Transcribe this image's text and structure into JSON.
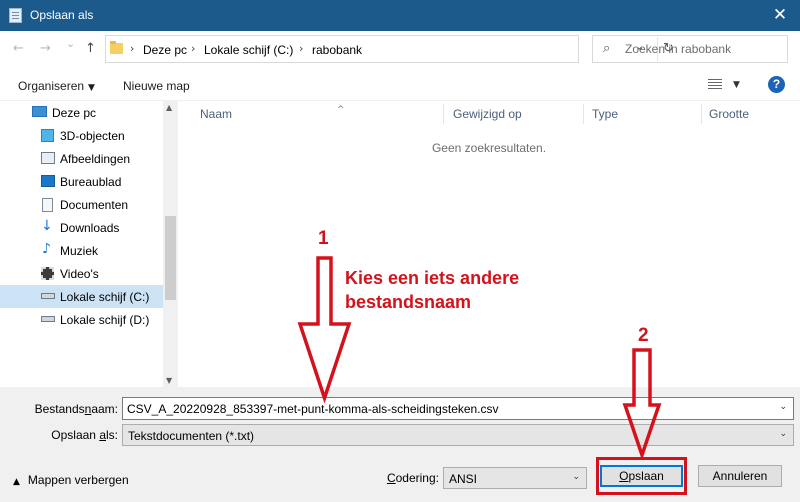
{
  "window": {
    "title": "Opslaan als",
    "close_glyph": "✕"
  },
  "nav_buttons": {
    "back": "←",
    "forward": "→",
    "recent": "⌄",
    "up": "↑"
  },
  "address": {
    "crumbs": [
      "Deze pc",
      "Lokale schijf (C:)",
      "rabobank"
    ],
    "separator": "›",
    "dropdown": "⌄",
    "refresh": "↻"
  },
  "search": {
    "placeholder": "Zoeken in rabobank",
    "icon": "⌕"
  },
  "toolbar": {
    "organize": "Organiseren",
    "organize_caret": "▼",
    "new_folder": "Nieuwe map",
    "view_caret": "▼",
    "help": "?"
  },
  "sidebar": {
    "items": [
      {
        "label": "Deze pc",
        "icon": "computer-icon"
      },
      {
        "label": "3D-objecten",
        "icon": "cube-icon"
      },
      {
        "label": "Afbeeldingen",
        "icon": "pictures-icon"
      },
      {
        "label": "Bureaublad",
        "icon": "desktop-icon"
      },
      {
        "label": "Documenten",
        "icon": "documents-icon"
      },
      {
        "label": "Downloads",
        "icon": "download-icon"
      },
      {
        "label": "Muziek",
        "icon": "music-icon"
      },
      {
        "label": "Video's",
        "icon": "video-icon"
      },
      {
        "label": "Lokale schijf (C:)",
        "icon": "drive-icon",
        "selected": true
      },
      {
        "label": "Lokale schijf (D:)",
        "icon": "drive-icon"
      }
    ],
    "scroll_up": "▲",
    "scroll_down": "▼"
  },
  "filelist": {
    "columns": [
      "Naam",
      "Gewijzigd op",
      "Type",
      "Grootte"
    ],
    "sort_indicator": "^",
    "empty_message": "Geen zoekresultaten."
  },
  "form": {
    "filename_label_pre": "Bestands",
    "filename_label_u": "n",
    "filename_label_post": "aam:",
    "filename_value": "CSV_A_20220928_853397-met-punt-komma-als-scheidingsteken.csv",
    "filetype_label_pre": "Opslaan ",
    "filetype_label_u": "a",
    "filetype_label_post": "ls:",
    "filetype_value": "Tekstdocumenten (*.txt)",
    "caret": "⌄",
    "hide_folders": "Mappen verbergen",
    "hide_caret": "▲",
    "encoding_label_pre": "",
    "encoding_label_u": "C",
    "encoding_label_post": "odering:",
    "encoding_value": "ANSI",
    "save_label_u": "O",
    "save_label_post": "pslaan",
    "cancel_label": "Annuleren"
  },
  "annotations": {
    "step1_number": "1",
    "step1_text_line1": "Kies een iets andere",
    "step1_text_line2": "bestandsnaam",
    "step2_number": "2",
    "color": "#d5121c"
  }
}
